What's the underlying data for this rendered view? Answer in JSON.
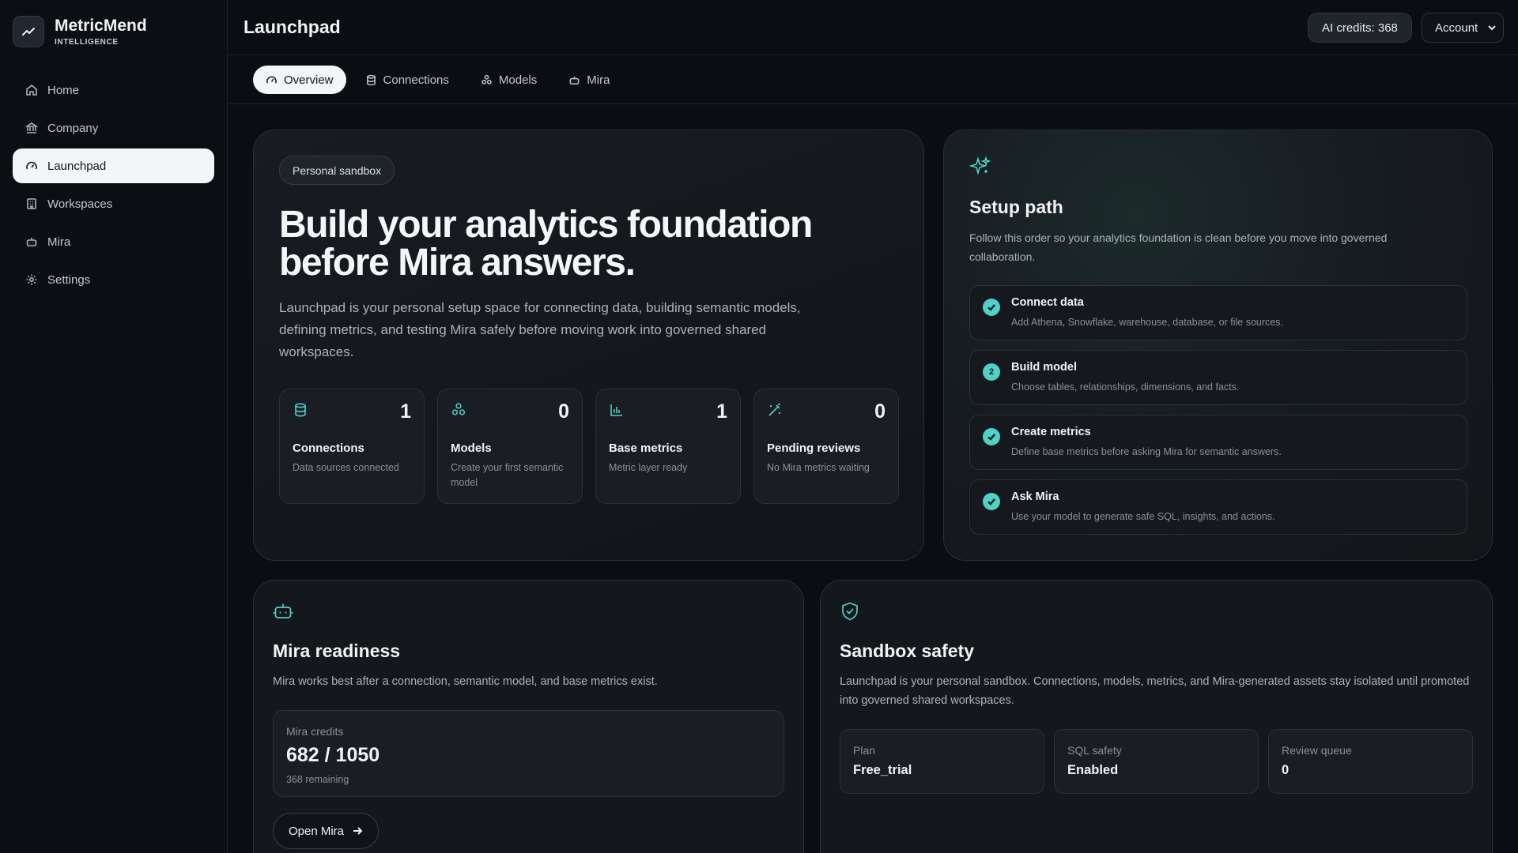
{
  "brand": {
    "name": "MetricMend",
    "sub": "INTELLIGENCE",
    "logo_icon": "trend-line-icon"
  },
  "sidebar": {
    "items": [
      {
        "label": "Home",
        "icon": "home-icon"
      },
      {
        "label": "Company",
        "icon": "bank-icon"
      },
      {
        "label": "Launchpad",
        "icon": "gauge-icon",
        "active": true
      },
      {
        "label": "Workspaces",
        "icon": "building-icon"
      },
      {
        "label": "Mira",
        "icon": "bot-icon"
      },
      {
        "label": "Settings",
        "icon": "gear-icon"
      }
    ]
  },
  "header": {
    "title": "Launchpad",
    "credits": "AI credits: 368",
    "account": "Account"
  },
  "tabs": [
    {
      "label": "Overview",
      "icon": "gauge-icon",
      "active": true
    },
    {
      "label": "Connections",
      "icon": "database-icon"
    },
    {
      "label": "Models",
      "icon": "model-icon"
    },
    {
      "label": "Mira",
      "icon": "bot-icon"
    }
  ],
  "hero": {
    "badge": "Personal sandbox",
    "title": "Build your analytics foundation before Mira answers.",
    "description": "Launchpad is your personal setup space for connecting data, building semantic models, defining metrics, and testing Mira safely before moving work into governed shared workspaces.",
    "stats": [
      {
        "value": "1",
        "label": "Connections",
        "sub": "Data sources connected",
        "icon": "database-icon"
      },
      {
        "value": "0",
        "label": "Models",
        "sub": "Create your first semantic model",
        "icon": "model-icon"
      },
      {
        "value": "1",
        "label": "Base metrics",
        "sub": "Metric layer ready",
        "icon": "bar-chart-icon"
      },
      {
        "value": "0",
        "label": "Pending reviews",
        "sub": "No Mira metrics waiting",
        "icon": "magic-wand-icon"
      }
    ]
  },
  "setup": {
    "title": "Setup path",
    "description": "Follow this order so your analytics foundation is clean before you move into governed collaboration.",
    "steps": [
      {
        "title": "Connect data",
        "sub": "Add Athena, Snowflake, warehouse, database, or file sources.",
        "status": "done"
      },
      {
        "title": "Build model",
        "sub": "Choose tables, relationships, dimensions, and facts.",
        "status": "current",
        "number": "2"
      },
      {
        "title": "Create metrics",
        "sub": "Define base metrics before asking Mira for semantic answers.",
        "status": "done"
      },
      {
        "title": "Ask Mira",
        "sub": "Use your model to generate safe SQL, insights, and actions.",
        "status": "done"
      }
    ]
  },
  "readiness": {
    "title": "Mira readiness",
    "description": "Mira works best after a connection, semantic model, and base metrics exist.",
    "credits_label": "Mira credits",
    "credits_value": "682 / 1050",
    "credits_remaining": "368 remaining",
    "open_button": "Open Mira"
  },
  "safety": {
    "title": "Sandbox safety",
    "description": "Launchpad is your personal sandbox. Connections, models, metrics, and Mira-generated assets stay isolated until promoted into governed shared workspaces.",
    "boxes": [
      {
        "label": "Plan",
        "value": "Free_trial"
      },
      {
        "label": "SQL safety",
        "value": "Enabled"
      },
      {
        "label": "Review queue",
        "value": "0"
      }
    ]
  },
  "colors": {
    "accent": "#4fd1c5",
    "background": "#0b0d12",
    "card": "#14171c"
  }
}
